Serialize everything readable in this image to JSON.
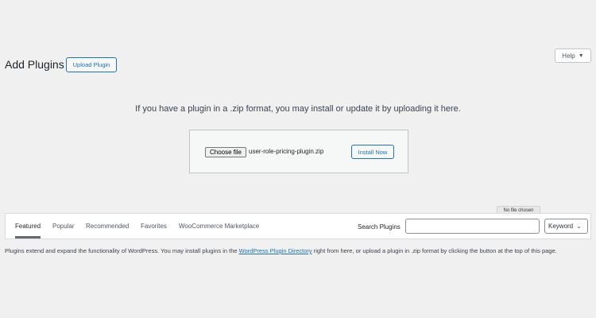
{
  "help": {
    "label": "Help",
    "icon": "caret-down-icon"
  },
  "header": {
    "title": "Add Plugins",
    "upload_button": "Upload Plugin"
  },
  "upload": {
    "help_text": "If you have a plugin in a .zip format, you may install or update it by uploading it here.",
    "choose_file_label": "Choose file",
    "file_name": "user-role-pricing-plugin.zip",
    "install_button": "Install Now",
    "tooltip": "No file chosen"
  },
  "tabs": [
    {
      "label": "Featured",
      "current": true
    },
    {
      "label": "Popular",
      "current": false
    },
    {
      "label": "Recommended",
      "current": false
    },
    {
      "label": "Favorites",
      "current": false
    },
    {
      "label": "WooCommerce Marketplace",
      "current": false
    }
  ],
  "search": {
    "label": "Search Plugins",
    "value": "",
    "type_selected": "Keyword"
  },
  "description": {
    "before_link": "Plugins extend and expand the functionality of WordPress. You may install plugins in the ",
    "link_text": "WordPress Plugin Directory",
    "after_link": " right from here, or upload a plugin in .zip format by clicking the button at the top of this page."
  },
  "colors": {
    "accent": "#2271b1",
    "background": "#f0f0f1",
    "text": "#1d2327"
  }
}
